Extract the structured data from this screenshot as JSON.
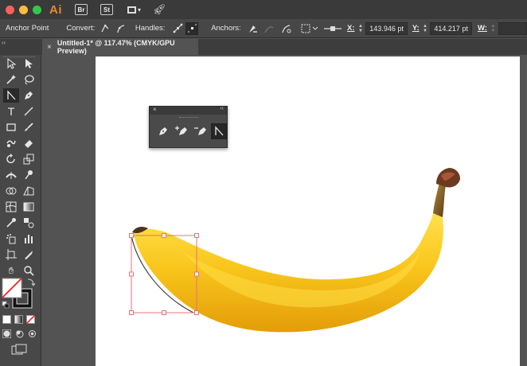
{
  "app": {
    "logo": "Ai",
    "bridge_badge": "Br",
    "stock_badge": "St"
  },
  "controlbar": {
    "tool_name": "Anchor Point",
    "convert_label": "Convert:",
    "handles_label": "Handles:",
    "anchors_label": "Anchors:",
    "x_label": "X:",
    "x_value": "143.946 pt",
    "y_label": "Y:",
    "y_value": "414.217 pt",
    "w_label": "W:"
  },
  "document": {
    "tab_close": "×",
    "tab_title": "Untitled-1* @ 117.47% (CMYK/GPU Preview)"
  },
  "flyout": {
    "close": "×",
    "collapse": "‹‹"
  },
  "colors": {
    "app_bg": "#535353",
    "artboard": "#ffffff",
    "selection": "#e8707f",
    "banana": "#f7c21a",
    "ai_orange": "#e68b2e"
  }
}
